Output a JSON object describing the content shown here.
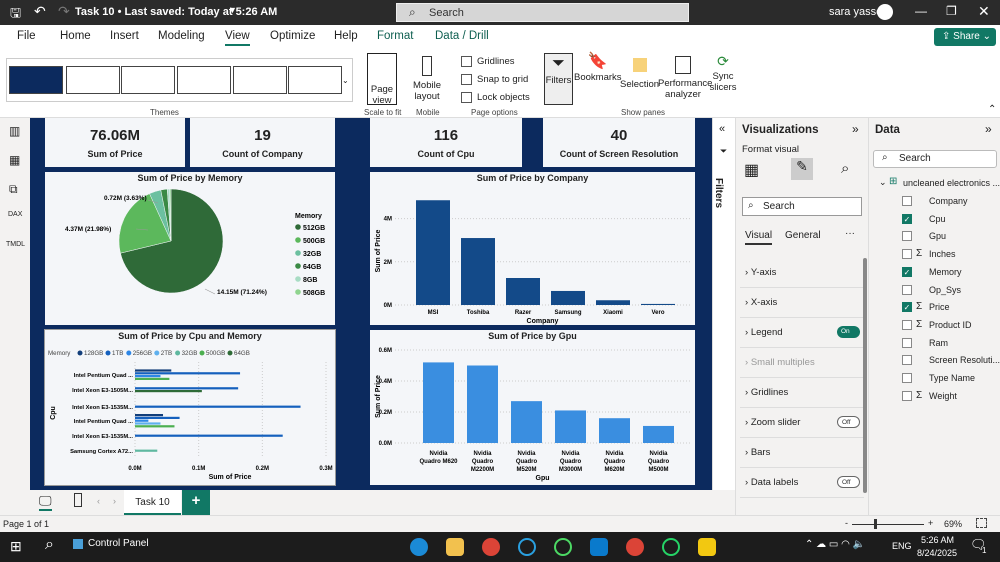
{
  "titlebar": {
    "doc_title": "Task 10 • Last saved: Today at 5:26 AM",
    "search": "Search",
    "user": "sara yasser"
  },
  "menu": [
    "File",
    "Home",
    "Insert",
    "Modeling",
    "View",
    "Optimize",
    "Help",
    "Format",
    "Data / Drill"
  ],
  "share": "Share",
  "ribbon": {
    "themes_label": "Themes",
    "page_view": "Page view",
    "scale_label": "Scale to fit",
    "mobile_layout": "Mobile layout",
    "mobile_label": "Mobile",
    "gridlines": "Gridlines",
    "snap": "Snap to grid",
    "lock": "Lock objects",
    "page_options": "Page options",
    "filters": "Filters",
    "bookmarks": "Bookmarks",
    "selection": "Selection",
    "perf": "Performance analyzer",
    "sync": "Sync slicers",
    "show_panes": "Show panes"
  },
  "kpis": [
    {
      "value": "76.06M",
      "label": "Sum of Price"
    },
    {
      "value": "19",
      "label": "Count of Company"
    },
    {
      "value": "116",
      "label": "Count of Cpu"
    },
    {
      "value": "40",
      "label": "Count of Screen Resolution"
    }
  ],
  "chart_data": [
    {
      "type": "pie",
      "title": "Sum of Price by Memory",
      "legend_title": "Memory",
      "legend_position": "right",
      "slices": [
        {
          "label": "512GB",
          "percent": 71.24,
          "value_label": "14.15M (71.24%)",
          "color": "#2f6a38"
        },
        {
          "label": "500GB",
          "percent": 21.98,
          "value_label": "4.37M (21.98%)",
          "color": "#5cb85c"
        },
        {
          "label": "32GB",
          "percent": 3.63,
          "value_label": "0.72M (3.63%)",
          "color": "#6cc0a0"
        },
        {
          "label": "64GB",
          "percent": 2.0,
          "color": "#3a8a45"
        },
        {
          "label": "8GB",
          "percent": 0.75,
          "color": "#a8dcc4"
        },
        {
          "label": "508GB",
          "percent": 0.4,
          "color": "#8fd48f"
        }
      ]
    },
    {
      "type": "bar",
      "title": "Sum of Price by Company",
      "xlabel": "Company",
      "ylabel": "Sum of Price",
      "ylim": [
        0,
        5
      ],
      "yticks": [
        "0M",
        "2M",
        "4M"
      ],
      "ytick_values": [
        0,
        2,
        4
      ],
      "categories": [
        "MSI",
        "Toshiba",
        "Razer",
        "Samsung",
        "Xiaomi",
        "Vero"
      ],
      "values": [
        4.85,
        3.1,
        1.25,
        0.65,
        0.22,
        0.05
      ],
      "unit": "M",
      "color": "#134a89",
      "grid": true
    },
    {
      "type": "bar",
      "orientation": "horizontal",
      "title": "Sum of Price by Cpu and Memory",
      "legend_title": "Memory",
      "legend_position": "top-left",
      "xlabel": "Sum of Price",
      "ylabel": "Cpu",
      "xlim": [
        0,
        0.3
      ],
      "xticks": [
        "0.0M",
        "0.1M",
        "0.2M",
        "0.3M"
      ],
      "xtick_values": [
        0,
        0.1,
        0.2,
        0.3
      ],
      "series": [
        {
          "name": "128GB",
          "color": "#123e7a"
        },
        {
          "name": "1TB",
          "color": "#1560bd"
        },
        {
          "name": "256GB",
          "color": "#2d86e6"
        },
        {
          "name": "2TB",
          "color": "#5fb0ee"
        },
        {
          "name": "32GB",
          "color": "#5fb8a0"
        },
        {
          "name": "500GB",
          "color": "#4caf50"
        },
        {
          "name": "64GB",
          "color": "#2e6b37"
        }
      ],
      "categories": [
        "Intel Pentium Quad ...",
        "Intel Xeon E3-1505M...",
        "Intel Xeon E3-1535M...",
        "Intel Pentium Quad ...",
        "Intel Xeon E3-1535M...",
        "Samsung Cortex A72..."
      ],
      "rows": [
        [
          {
            "s": "128GB",
            "v": 0.057
          },
          {
            "s": "1TB",
            "v": 0.165
          },
          {
            "s": "256GB",
            "v": 0.04
          },
          {
            "s": "500GB",
            "v": 0.054
          }
        ],
        [
          {
            "s": "1TB",
            "v": 0.162
          },
          {
            "s": "64GB",
            "v": 0.105
          }
        ],
        [
          {
            "s": "1TB",
            "v": 0.26
          }
        ],
        [
          {
            "s": "128GB",
            "v": 0.044
          },
          {
            "s": "1TB",
            "v": 0.07
          },
          {
            "s": "256GB",
            "v": 0.021
          },
          {
            "s": "2TB",
            "v": 0.04
          },
          {
            "s": "500GB",
            "v": 0.062
          }
        ],
        [
          {
            "s": "1TB",
            "v": 0.232
          }
        ],
        [
          {
            "s": "32GB",
            "v": 0.035
          }
        ]
      ]
    },
    {
      "type": "bar",
      "title": "Sum of Price by Gpu",
      "xlabel": "Gpu",
      "ylabel": "Sum of Price",
      "ylim": [
        0,
        0.6
      ],
      "yticks": [
        "0.0M",
        "0.2M",
        "0.4M",
        "0.6M"
      ],
      "ytick_values": [
        0,
        0.2,
        0.4,
        0.6
      ],
      "categories": [
        [
          "Nvidia",
          "Quadro M620"
        ],
        [
          "Nvidia",
          "Quadro",
          "M2200M"
        ],
        [
          "Nvidia",
          "Quadro",
          "M520M"
        ],
        [
          "Nvidia",
          "Quadro",
          "M3000M"
        ],
        [
          "Nvidia",
          "Quadro",
          "M620M"
        ],
        [
          "Nvidia",
          "Quadro",
          "M500M"
        ]
      ],
      "values": [
        0.52,
        0.5,
        0.27,
        0.21,
        0.16,
        0.11
      ],
      "unit": "M",
      "color": "#3a8ee0",
      "grid": true
    }
  ],
  "filters_label": "Filters",
  "viz": {
    "title": "Visualizations",
    "format_visual": "Format visual",
    "search": "Search",
    "tab_visual": "Visual",
    "tab_general": "General",
    "more": "···",
    "sections": [
      {
        "label": "Y-axis"
      },
      {
        "label": "X-axis"
      },
      {
        "label": "Legend",
        "toggle": "On"
      },
      {
        "label": "Small multiples",
        "disabled": true
      },
      {
        "label": "Gridlines"
      },
      {
        "label": "Zoom slider",
        "toggle": "Off"
      },
      {
        "label": "Bars"
      },
      {
        "label": "Data labels",
        "toggle": "Off"
      }
    ]
  },
  "data": {
    "title": "Data",
    "search": "Search",
    "table": "uncleaned electronics ...",
    "fields": [
      {
        "name": "Company",
        "checked": false,
        "sigma": false
      },
      {
        "name": "Cpu",
        "checked": true,
        "sigma": false
      },
      {
        "name": "Gpu",
        "checked": false,
        "sigma": false
      },
      {
        "name": "Inches",
        "checked": false,
        "sigma": true
      },
      {
        "name": "Memory",
        "checked": true,
        "sigma": false
      },
      {
        "name": "Op_Sys",
        "checked": false,
        "sigma": false
      },
      {
        "name": "Price",
        "checked": true,
        "sigma": true
      },
      {
        "name": "Product ID",
        "checked": false,
        "sigma": true
      },
      {
        "name": "Ram",
        "checked": false,
        "sigma": false
      },
      {
        "name": "Screen Resoluti...",
        "checked": false,
        "sigma": false
      },
      {
        "name": "Type Name",
        "checked": false,
        "sigma": false
      },
      {
        "name": "Weight",
        "checked": false,
        "sigma": true
      }
    ]
  },
  "page_tab": "Task 10",
  "add_page": "+",
  "status": {
    "page": "Page 1 of 1",
    "zoom": "69%",
    "zoom_minus": "-",
    "zoom_plus": "+"
  },
  "taskbar": {
    "control_panel": "Control Panel",
    "lang": "ENG",
    "time": "5:26 AM",
    "date": "8/24/2025",
    "notif": "1"
  }
}
